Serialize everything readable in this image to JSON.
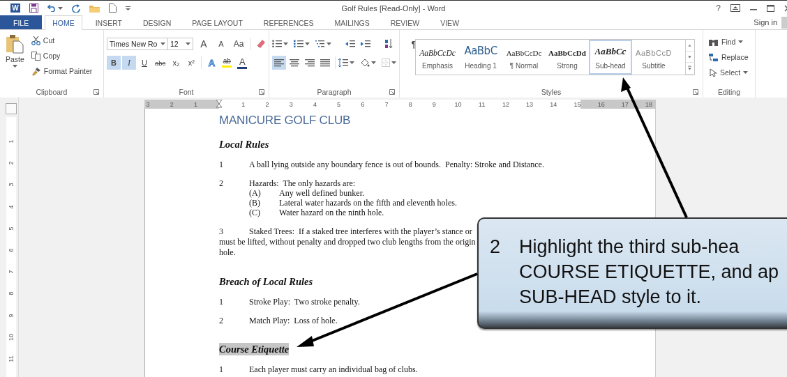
{
  "window": {
    "app_icon": "W",
    "title": "Golf Rules [Read-Only] - Word",
    "help": "?"
  },
  "ribbon_tabs": [
    {
      "label": "FILE",
      "kind": "file",
      "selected": false
    },
    {
      "label": "HOME",
      "kind": "tab",
      "selected": true
    },
    {
      "label": "INSERT",
      "kind": "tab",
      "selected": false
    },
    {
      "label": "DESIGN",
      "kind": "tab",
      "selected": false
    },
    {
      "label": "PAGE LAYOUT",
      "kind": "tab",
      "selected": false
    },
    {
      "label": "REFERENCES",
      "kind": "tab",
      "selected": false
    },
    {
      "label": "MAILINGS",
      "kind": "tab",
      "selected": false
    },
    {
      "label": "REVIEW",
      "kind": "tab",
      "selected": false
    },
    {
      "label": "VIEW",
      "kind": "tab",
      "selected": false
    }
  ],
  "sign_in": "Sign in",
  "clipboard": {
    "paste": "Paste",
    "items": [
      "Cut",
      "Copy",
      "Format Painter"
    ],
    "label": "Clipboard"
  },
  "font": {
    "name": "Times New Ro",
    "size": "12",
    "grow": "A",
    "shrink": "A",
    "case": "Aa",
    "format_buttons": [
      {
        "label": "B",
        "selected": true
      },
      {
        "label": "I",
        "selected": true
      },
      {
        "label": "U",
        "selected": false
      },
      {
        "label": "abc",
        "selected": false
      },
      {
        "label": "x₂",
        "selected": false
      },
      {
        "label": "x²",
        "selected": false
      }
    ],
    "effects": [
      {
        "label": "A",
        "kind": "effects"
      },
      {
        "label": "ab",
        "kind": "highlight"
      },
      {
        "label": "A",
        "kind": "color"
      }
    ],
    "label": "Font"
  },
  "paragraph": {
    "show_marks": "¶",
    "alignment": [
      {
        "selected": true
      },
      {
        "selected": false
      },
      {
        "selected": false
      },
      {
        "selected": false
      }
    ],
    "label": "Paragraph"
  },
  "styles": {
    "items": [
      {
        "preview": "AaBbCcDc",
        "name": "Emphasis",
        "kind": "emphasis",
        "selected": false
      },
      {
        "preview": "AaBbC",
        "name": "Heading 1",
        "kind": "heading",
        "selected": false
      },
      {
        "preview": "AaBbCcDc",
        "name": "¶ Normal",
        "kind": "normal",
        "selected": false
      },
      {
        "preview": "AaBbCcDd",
        "name": "Strong",
        "kind": "strong",
        "selected": false
      },
      {
        "preview": "AaBbCc",
        "name": "Sub-head",
        "kind": "subhead",
        "selected": true
      },
      {
        "preview": "AaBbCcD",
        "name": "Subtitle",
        "kind": "subtitle",
        "selected": false
      }
    ],
    "label": "Styles"
  },
  "editing": {
    "items": [
      {
        "label": "Find",
        "kind": "find"
      },
      {
        "label": "Replace",
        "kind": "replace"
      },
      {
        "label": "Select",
        "kind": "select"
      }
    ],
    "label": "Editing"
  },
  "ruler": {
    "horizontal": [
      "3",
      "2",
      "1",
      "1",
      "2",
      "3",
      "4",
      "5",
      "6",
      "7",
      "8",
      "9",
      "10",
      "11",
      "12",
      "13",
      "14",
      "15",
      "16",
      "17",
      "18"
    ],
    "vertical": [
      "1",
      "2",
      "3",
      "4",
      "5",
      "6",
      "7",
      "8",
      "9",
      "10",
      "11"
    ]
  },
  "document": {
    "title": "MANICURE GOLF CLUB",
    "sections": [
      {
        "heading": "Local Rules",
        "highlighted": false,
        "items": [
          {
            "kind": "item",
            "number": "1",
            "text": "A ball lying outside any boundary fence is out of bounds.  Penalty: Stroke and Distance."
          },
          {
            "kind": "item",
            "number": "2",
            "text": "Hazards:  The only hazards are:",
            "children": [
              {
                "number": "(A)",
                "text": "Any well defined bunker."
              },
              {
                "number": "(B)",
                "text": "Lateral water hazards on the fifth and eleventh holes."
              },
              {
                "number": "(C)",
                "text": "Water hazard on the ninth hole."
              }
            ]
          },
          {
            "kind": "para",
            "number": "3",
            "lines": [
              "Staked Trees:  If a staked tree interferes with the player’s stance or",
              "must be lifted, without penalty and dropped two club lengths from the origin",
              "hole."
            ]
          }
        ]
      },
      {
        "heading": "Breach of Local Rules",
        "highlighted": false,
        "items": [
          {
            "kind": "item",
            "number": "1",
            "text": "Stroke Play:  Two stroke penalty."
          },
          {
            "kind": "item",
            "number": "2",
            "text": "Match Play:  Loss of hole."
          }
        ]
      },
      {
        "heading": "Course Etiquette",
        "highlighted": true,
        "items": [
          {
            "kind": "item",
            "number": "1",
            "text": "Each player must carry an individual bag of clubs."
          }
        ]
      }
    ]
  },
  "callout": {
    "number": "2",
    "lines": [
      "Highlight the third sub-hea",
      "COURSE ETIQUETTE, and ap",
      "SUB-HEAD style to it."
    ]
  }
}
